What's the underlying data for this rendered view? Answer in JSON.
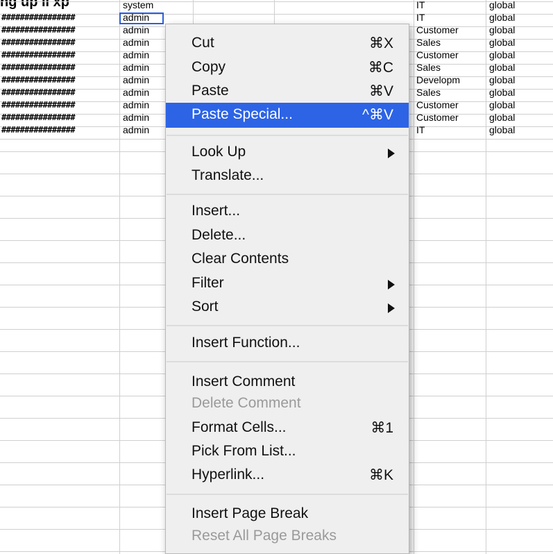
{
  "sheet": {
    "top_cut_text": "ng up  ll  xp",
    "col_a": [
      "################",
      "################",
      "################",
      "################",
      "################",
      "################",
      "################",
      "################",
      "################",
      "################"
    ],
    "col_b": [
      "system",
      "admin",
      "admin",
      "admin",
      "admin",
      "admin",
      "admin",
      "admin",
      "admin",
      "admin",
      "admin"
    ],
    "col_e": [
      "IT",
      "IT",
      "Customer",
      "Sales",
      "Customer",
      "Sales",
      "Developm",
      "Sales",
      "Customer",
      "Customer",
      "IT"
    ],
    "col_f": [
      "global",
      "global",
      "global",
      "global",
      "global",
      "global",
      "global",
      "global",
      "global",
      "global",
      "global"
    ]
  },
  "menu": {
    "cut": {
      "label": "Cut",
      "shortcut": "⌘X"
    },
    "copy": {
      "label": "Copy",
      "shortcut": "⌘C"
    },
    "paste": {
      "label": "Paste",
      "shortcut": "⌘V"
    },
    "paste_special": {
      "label": "Paste Special...",
      "shortcut": "^⌘V"
    },
    "look_up": {
      "label": "Look Up"
    },
    "translate": {
      "label": "Translate..."
    },
    "insert": {
      "label": "Insert..."
    },
    "delete": {
      "label": "Delete..."
    },
    "clear_contents": {
      "label": "Clear Contents"
    },
    "filter": {
      "label": "Filter"
    },
    "sort": {
      "label": "Sort"
    },
    "insert_function": {
      "label": "Insert Function..."
    },
    "insert_comment": {
      "label": "Insert Comment"
    },
    "delete_comment": {
      "label": "Delete Comment"
    },
    "format_cells": {
      "label": "Format Cells...",
      "shortcut": "⌘1"
    },
    "pick_from_list": {
      "label": "Pick From List..."
    },
    "hyperlink": {
      "label": "Hyperlink...",
      "shortcut": "⌘K"
    },
    "insert_page_break": {
      "label": "Insert Page Break"
    },
    "reset_page_breaks": {
      "label": "Reset All Page Breaks"
    }
  },
  "colors": {
    "highlight": "#2d64e6",
    "disabled_text": "#9a9a9a",
    "selection_border": "#2c5fd9"
  }
}
